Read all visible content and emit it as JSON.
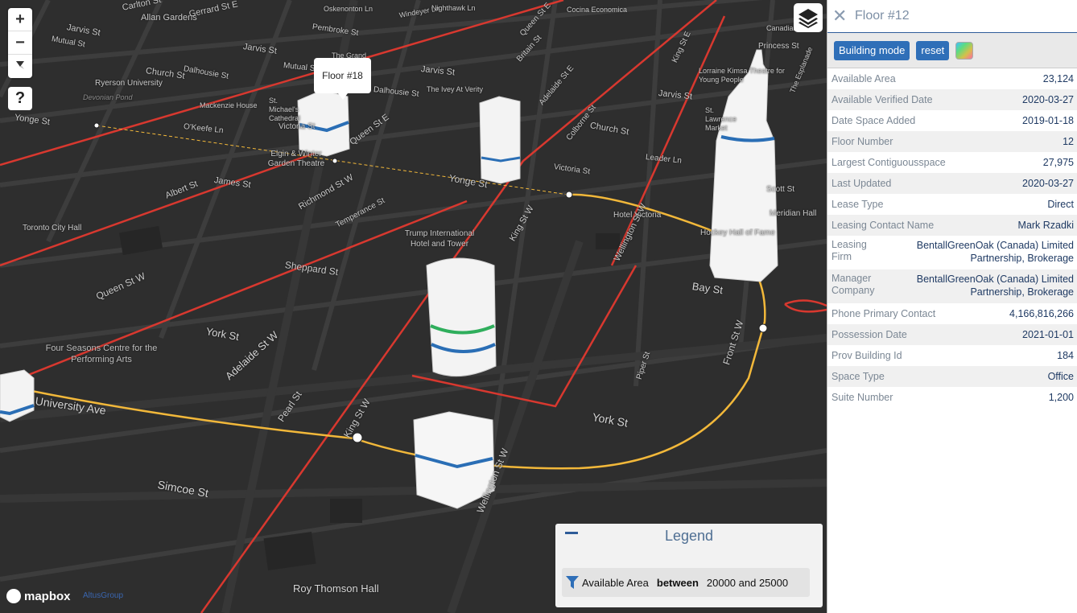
{
  "map": {
    "streets": {
      "carlton": "Carlton St",
      "allan_gardens": "Allan Gardens",
      "gerrard_e": "Gerrard St E",
      "oskenonton": "Oskenonton Ln",
      "windeyer": "Windeyer Ln",
      "nighthawk": "Nighthawk Ln",
      "cocina": "Cocina Economica",
      "canadian": "Canadian",
      "jarvis1": "Jarvis St",
      "mutual1": "Mutual St",
      "gerrard_w": "Gerrard St E",
      "pembroke": "Pembroke St",
      "queen_e1": "Queen St E",
      "britain": "Britain St",
      "king_e": "King St E",
      "princess": "Princess St",
      "jarvis2": "Jarvis St",
      "mutual2": "Mutual St",
      "church1": "Church St",
      "dalhousie1": "Dalhousie St",
      "the_grand": "The Grand",
      "jarvis3": "Jarvis St",
      "ryerson": "Ryerson University",
      "devonian": "Devonian Pond",
      "mackenzie": "Mackenzie House",
      "dalhousie2": "Dalhousie St",
      "ivey": "The Ivey At Verity",
      "adelaide_e": "Adelaide St E",
      "lorraine": "Lorraine Kimsa Theatre for Young People",
      "jarvis4": "Jarvis St",
      "st_lawrence": "St. Lawrence Market",
      "esplanade": "The Esplanade",
      "yonge1": "Yonge St",
      "okeefe": "O'Keefe Ln",
      "victoria1": "Victoria St",
      "st_mikes": "St. Michael's Cathedral",
      "queen_e2": "Queen St E",
      "church2": "Church St",
      "colborne": "Colborne St",
      "leader": "Leader Ln",
      "scott": "Scott St",
      "elgin": "Elgin & Winter Garden Theatre",
      "yonge2": "Yonge St",
      "victoria2": "Victoria St",
      "albert": "Albert St",
      "james": "James St",
      "richmond_w": "Richmond St W",
      "temperance": "Temperance St",
      "king_w1": "King St W",
      "hotel_victoria": "Hotel Victoria",
      "meridian": "Meridian Hall",
      "toronto_city_hall": "Toronto City Hall",
      "trump": "Trump International Hotel and Tower",
      "wellington_w1": "Wellington St W",
      "hockey": "Hockey Hall of Fame",
      "sheppard": "Sheppard St",
      "queen_w": "Queen St W",
      "bay": "Bay St",
      "york1": "York St",
      "adelaide_w": "Adelaide St W",
      "four_seasons": "Four Seasons Centre for the Performing Arts",
      "front_w": "Front St W",
      "piper": "Piper St",
      "university": "University Ave",
      "pearl": "Pearl St",
      "king_w2": "King St W",
      "york2": "York St",
      "wellington_w2": "Wellington St W",
      "simcoe": "Simcoe St",
      "roy_thomson": "Roy Thomson Hall"
    },
    "popup_label": "Floor #18",
    "help_label": "?",
    "zoom_in_label": "+",
    "zoom_out_label": "−",
    "attribution": "mapbox",
    "brand": "AltusGroup"
  },
  "legend": {
    "title": "Legend",
    "filter_field": "Available Area",
    "filter_op": "between",
    "filter_value": "20000 and 25000"
  },
  "panel": {
    "title": "Floor #12",
    "close_label": "✕",
    "building_mode_label": "Building mode",
    "reset_label": "reset",
    "rows": [
      {
        "key": "Available Area",
        "value": "23,124"
      },
      {
        "key": "Available Verified Date",
        "value": "2020-03-27"
      },
      {
        "key": "Date Space Added",
        "value": "2019-01-18"
      },
      {
        "key": "Floor Number",
        "value": "12"
      },
      {
        "key": "Largest Contiguousspace",
        "value": "27,975"
      },
      {
        "key": "Last Updated",
        "value": "2020-03-27"
      },
      {
        "key": "Lease Type",
        "value": "Direct"
      },
      {
        "key": "Leasing Contact Name",
        "value": "Mark Rzadki"
      },
      {
        "key": "Leasing Firm",
        "value": "BentallGreenOak (Canada) Limited Partnership, Brokerage"
      },
      {
        "key": "Manager Company",
        "value": "BentallGreenOak (Canada) Limited Partnership, Brokerage"
      },
      {
        "key": "Phone Primary Contact",
        "value": "4,166,816,266"
      },
      {
        "key": "Possession Date",
        "value": "2021-01-01"
      },
      {
        "key": "Prov Building Id",
        "value": "184"
      },
      {
        "key": "Space Type",
        "value": "Office"
      },
      {
        "key": "Suite Number",
        "value": "1,200"
      }
    ]
  },
  "colors": {
    "map_bg": "#2d2d2d",
    "road_red": "#d8382f",
    "route_yellow": "#f2b83a",
    "floor_blue": "#2a6eb5",
    "floor_green": "#2fae5c",
    "accent": "#2f6fb8"
  }
}
